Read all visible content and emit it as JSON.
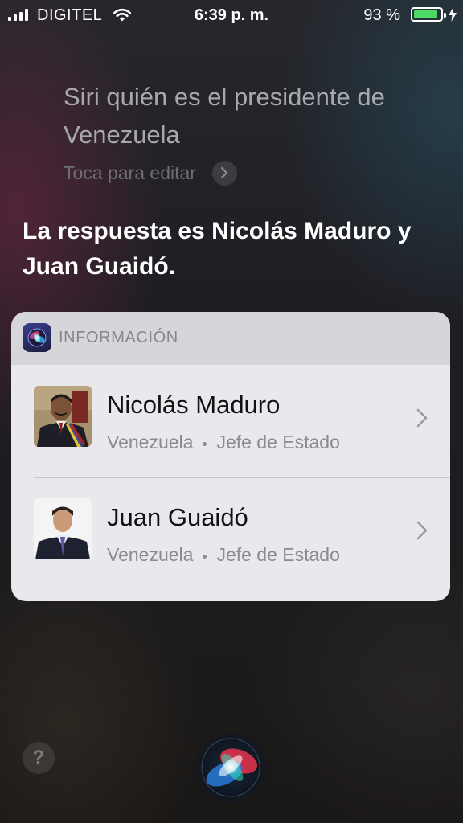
{
  "status_bar": {
    "carrier": "DIGITEL",
    "time": "6:39 p. m.",
    "battery_percent": "93 %",
    "battery_level": 0.93,
    "icons": [
      "signal-bars-icon",
      "wifi-icon",
      "battery-icon",
      "charging-bolt-icon"
    ]
  },
  "query": {
    "text": "Siri quién es el presidente de Venezuela",
    "edit_hint": "Toca para editar"
  },
  "answer": "La respuesta es Nicolás Maduro y Juan Guaidó.",
  "card": {
    "header": "INFORMACIÓN",
    "header_icon": "siri-app-icon",
    "results": [
      {
        "name": "Nicolás Maduro",
        "country": "Venezuela",
        "role": "Jefe de Estado"
      },
      {
        "name": "Juan Guaidó",
        "country": "Venezuela",
        "role": "Jefe de Estado"
      }
    ]
  },
  "bottom": {
    "help_label": "?",
    "siri_icon": "siri-orb-icon"
  },
  "colors": {
    "battery_green": "#4cd964",
    "card_background": "#e9e8ed",
    "card_header": "#d6d5da"
  }
}
